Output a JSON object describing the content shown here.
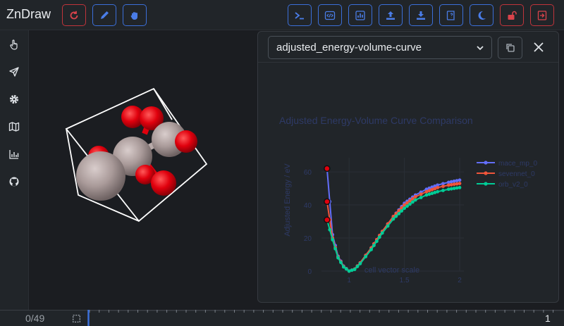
{
  "app": {
    "title": "ZnDraw"
  },
  "toolbar": {
    "left_buttons": [
      {
        "name": "refresh-button",
        "icon": "refresh-icon"
      },
      {
        "name": "drawing-button",
        "icon": "pencil-icon"
      },
      {
        "name": "interaction-button",
        "icon": "hand-icon"
      }
    ],
    "right_buttons": [
      {
        "name": "console-button",
        "icon": "terminal-icon"
      },
      {
        "name": "code-button",
        "icon": "code-icon"
      },
      {
        "name": "analysis-button",
        "icon": "chart-icon"
      },
      {
        "name": "upload-button",
        "icon": "upload-icon"
      },
      {
        "name": "download-button",
        "icon": "download-icon"
      },
      {
        "name": "help-button",
        "icon": "book-icon"
      },
      {
        "name": "theme-button",
        "icon": "moon-icon"
      },
      {
        "name": "lock-button",
        "icon": "unlock-icon"
      },
      {
        "name": "logout-button",
        "icon": "exit-icon"
      }
    ]
  },
  "sidebar": {
    "items": [
      {
        "name": "sidebar-item-selection",
        "icon": "pointer-icon"
      },
      {
        "name": "sidebar-item-interaction",
        "icon": "send-icon"
      },
      {
        "name": "sidebar-item-settings",
        "icon": "gear-icon"
      },
      {
        "name": "sidebar-item-geometry",
        "icon": "map-icon"
      },
      {
        "name": "sidebar-item-analysis",
        "icon": "bar-chart-icon"
      },
      {
        "name": "sidebar-item-github",
        "icon": "github-icon"
      }
    ]
  },
  "panel": {
    "select_value": "adjusted_energy-volume-curve"
  },
  "chart_data": {
    "type": "line",
    "title": "Adjusted Energy-Volume Curve Comparison",
    "xlabel": "cell vector scale",
    "ylabel": "Adjusted Energy / eV",
    "xlim": [
      0.75,
      2.0
    ],
    "ylim": [
      0,
      66
    ],
    "xticks": [
      "1",
      "1.5",
      "2"
    ],
    "yticks": [
      "0",
      "20",
      "40",
      "60"
    ],
    "grid": true,
    "legend_position": "top-right",
    "highlighted_points": [
      {
        "x": 0.8,
        "y": 62
      },
      {
        "x": 0.8,
        "y": 42
      },
      {
        "x": 0.8,
        "y": 31
      }
    ],
    "series": [
      {
        "name": "mace_mp_0",
        "color": "#636efa",
        "x": [
          0.8,
          0.85,
          0.9,
          0.95,
          1.0,
          1.05,
          1.1,
          1.2,
          1.3,
          1.4,
          1.5,
          1.6,
          1.7,
          1.8,
          1.9,
          2.0
        ],
        "y": [
          62,
          22,
          9,
          3,
          0,
          1.2,
          5,
          14,
          24,
          33,
          41,
          46,
          49.5,
          52,
          53.7,
          55
        ]
      },
      {
        "name": "sevennet_0",
        "color": "#ef553b",
        "x": [
          0.8,
          0.85,
          0.9,
          0.95,
          1.0,
          1.05,
          1.1,
          1.2,
          1.3,
          1.4,
          1.5,
          1.6,
          1.7,
          1.8,
          1.9,
          2.0
        ],
        "y": [
          42,
          20,
          8.5,
          2.8,
          0,
          1.2,
          5,
          14,
          24,
          33,
          40,
          45,
          48,
          50.5,
          52,
          53
        ]
      },
      {
        "name": "orb_v2_0",
        "color": "#00cc96",
        "x": [
          0.8,
          0.85,
          0.9,
          0.95,
          1.0,
          1.05,
          1.1,
          1.2,
          1.3,
          1.4,
          1.5,
          1.6,
          1.7,
          1.8,
          1.9,
          2.0
        ],
        "y": [
          31,
          19,
          8,
          2.5,
          0,
          1,
          4.5,
          13,
          23,
          31.5,
          38,
          43,
          46,
          48,
          49.5,
          50.5
        ]
      }
    ]
  },
  "bottom": {
    "frame_indicator": "0/49",
    "total": "1"
  },
  "colors": {
    "accent": "#3b6fd9",
    "danger": "#c0343b",
    "background": "#1b1d21",
    "panel": "#212529"
  }
}
